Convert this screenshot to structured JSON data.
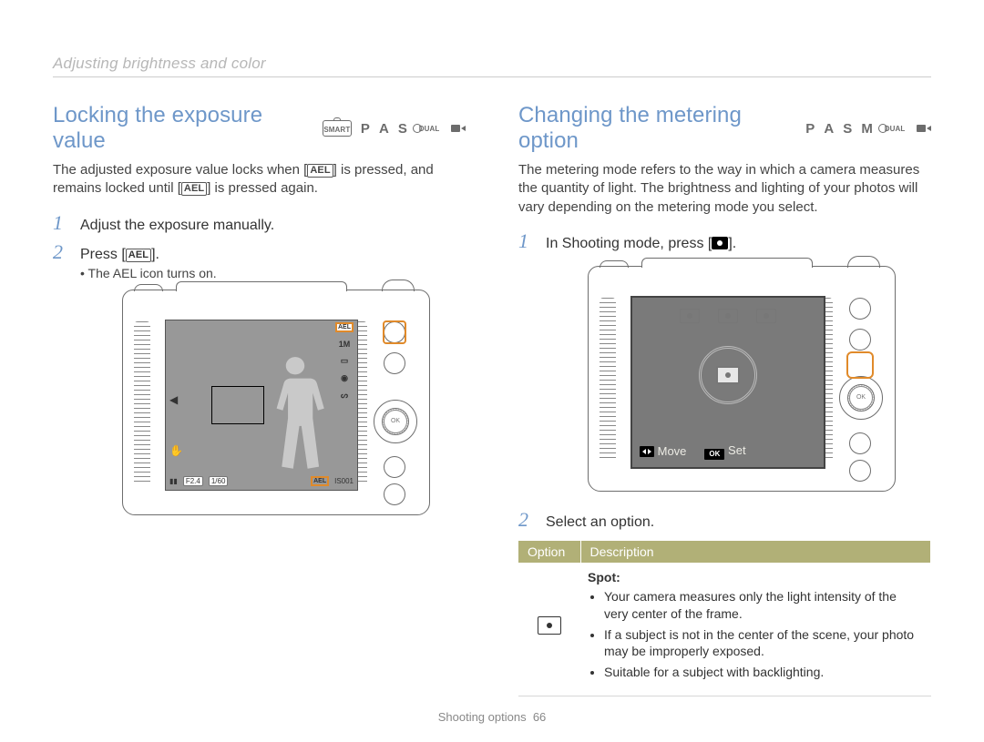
{
  "breadcrumb": "Adjusting brightness and color",
  "left": {
    "title": "Locking the exposure value",
    "modes_smart": "SMART",
    "modes": [
      "P",
      "A",
      "S"
    ],
    "modes_dual": "DUAL",
    "intro_part1": "The adjusted exposure value locks when [",
    "intro_part2": "] is pressed, and remains locked until [",
    "intro_part3": "] is pressed again.",
    "step1_num": "1",
    "step1_text": "Adjust the exposure manually.",
    "step2_num": "2",
    "step2_text_pre": "Press [",
    "step2_text_post": "].",
    "step2_bullet": "The AEL icon turns on.",
    "lcd": {
      "side_icons": [
        "1M",
        "▭",
        "◉",
        "ᔕ"
      ],
      "bottom_f": "F2.4",
      "bottom_s": "1/60",
      "bottom_iso": "IS001",
      "ael": "AEL"
    }
  },
  "right": {
    "title": "Changing the metering option",
    "modes": [
      "P",
      "A",
      "S",
      "M"
    ],
    "modes_dual": "DUAL",
    "intro": "The metering mode refers to the way in which a camera measures the quantity of light. The brightness and lighting of your photos will vary depending on the metering mode you select.",
    "step1_num": "1",
    "step1_text_pre": "In Shooting mode, press [",
    "step1_text_post": "].",
    "lcd": {
      "move": "Move",
      "set": "Set",
      "ok": "OK"
    },
    "step2_num": "2",
    "step2_text": "Select an option.",
    "table": {
      "h_option": "Option",
      "h_desc": "Description",
      "row_title": "Spot:",
      "b1": "Your camera measures only the light intensity of the very center of the frame.",
      "b2": "If a subject is not in the center of the scene, your photo may be improperly exposed.",
      "b3": "Suitable for a subject with backlighting."
    }
  },
  "icons": {
    "ael": "AEL",
    "ok": "OK"
  },
  "footer": {
    "section": "Shooting options",
    "page": "66"
  }
}
